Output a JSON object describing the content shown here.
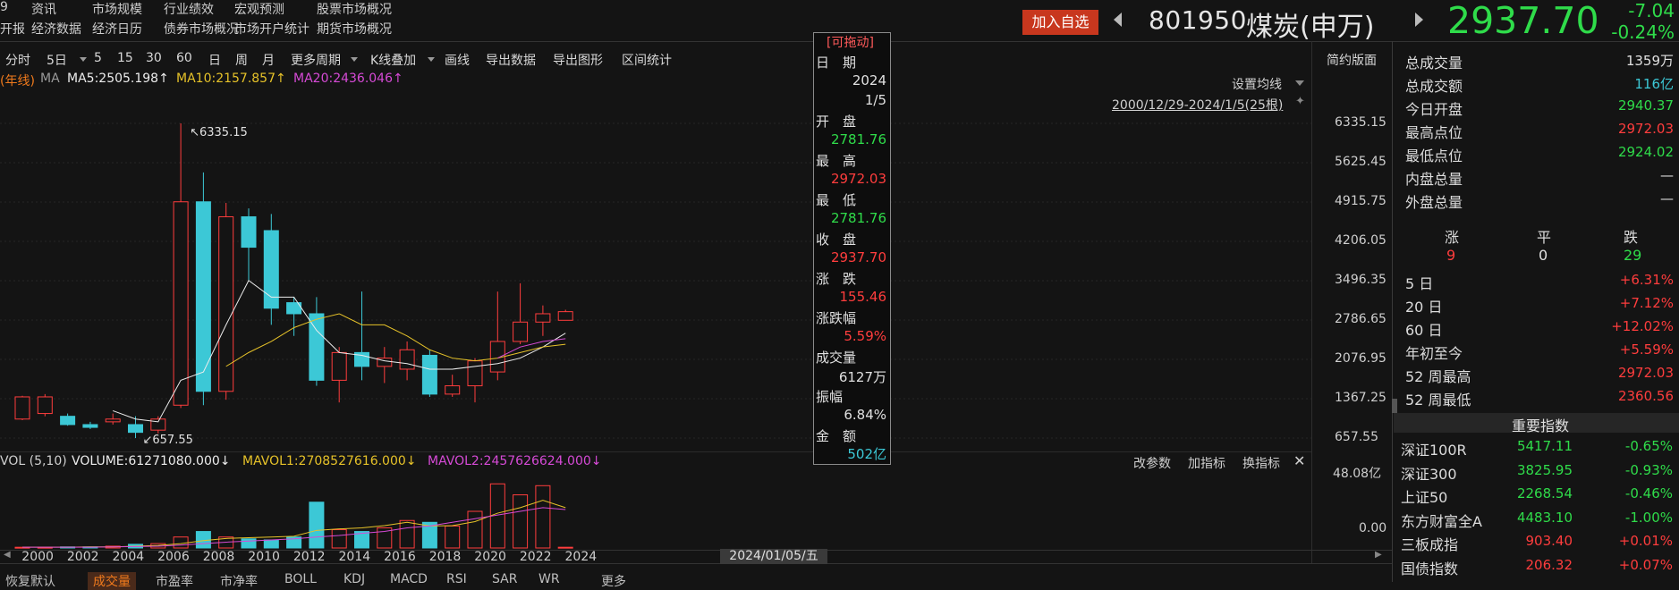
{
  "topnav": {
    "row1": [
      "9",
      "资讯",
      "市场规模",
      "行业绩效",
      "宏观预测",
      "股票市场概况"
    ],
    "row2": [
      "开报",
      "经济数据",
      "经济日历",
      "债券市场概况",
      "市场开户统计",
      "期货市场概况"
    ]
  },
  "header": {
    "add_label": "加入自选",
    "code": "801950",
    "name": "煤炭(申万)",
    "price": "2937.70",
    "change": "-7.04",
    "change_pct": "-0.24%",
    "color_up": "#ff3d3d",
    "color_down": "#2fdc4a"
  },
  "toolbar": {
    "items": [
      "分时",
      "5日",
      "5",
      "15",
      "30",
      "60",
      "日",
      "周",
      "月",
      "更多周期",
      "K线叠加",
      "画线",
      "导出数据",
      "导出图形",
      "区间统计"
    ],
    "simple_label": "简约版面"
  },
  "ma": {
    "prefix": "(年线)",
    "ma_label": "MA",
    "ma5": "MA5:2505.198↑",
    "ma10": "MA10:2157.857↑",
    "ma20": "MA20:2436.046↑",
    "setting": "设置均线",
    "range": "2000/12/29-2024/1/5(25根)"
  },
  "vol": {
    "label": "VOL (5,10)",
    "volume": "VOLUME:61271080.000↓",
    "mavol1": "MAVOL1:2708527616.000↓",
    "mavol2": "MAVOL2:2457626624.000↓",
    "btn_params": "改参数",
    "btn_add": "加指标",
    "btn_switch": "换指标",
    "close_icon": "close-icon",
    "yaxis": [
      "48.08亿",
      "0.00"
    ]
  },
  "tooltip": {
    "drag": "[可拖动]",
    "date_label": "日　期",
    "date_year": "2024",
    "date_md": "1/5",
    "open_label": "开　盘",
    "open": "2781.76",
    "high_label": "最　高",
    "high": "2972.03",
    "low_label": "最　低",
    "low": "2781.76",
    "close_label": "收　盘",
    "close": "2937.70",
    "chg_label": "涨　跌",
    "chg": "155.46",
    "chgpct_label": "涨跌幅",
    "chgpct": "5.59%",
    "vol_label": "成交量",
    "vol": "6127万",
    "amp_label": "振幅",
    "amp": "6.84%",
    "amt_label": "金　额",
    "amt": "502亿"
  },
  "xaxis": {
    "years": [
      "2000",
      "2002",
      "2004",
      "2006",
      "2008",
      "2010",
      "2012",
      "2014",
      "2016",
      "2018",
      "2020",
      "2022",
      "2024"
    ],
    "cursor_date": "2024/01/05/五"
  },
  "bottom_tabs": [
    "恢复默认",
    "成交量",
    "市盈率",
    "市净率",
    "BOLL",
    "KDJ",
    "MACD",
    "RSI",
    "SAR",
    "WR",
    "更多"
  ],
  "stats": [
    {
      "label": "总成交量",
      "value": "1359万",
      "color": "white"
    },
    {
      "label": "总成交额",
      "value": "116亿",
      "color": "cyan"
    },
    {
      "label": "今日开盘",
      "value": "2940.37",
      "color": "green"
    },
    {
      "label": "最高点位",
      "value": "2972.03",
      "color": "red"
    },
    {
      "label": "最低点位",
      "value": "2924.02",
      "color": "green"
    },
    {
      "label": "内盘总量",
      "value": "—",
      "color": "white"
    },
    {
      "label": "外盘总量",
      "value": "—",
      "color": "white"
    }
  ],
  "breadth": {
    "up_label": "涨",
    "flat_label": "平",
    "down_label": "跌",
    "up": "9",
    "flat": "0",
    "down": "29"
  },
  "periods": [
    {
      "label": "5 日",
      "value": "+6.31%"
    },
    {
      "label": "20 日",
      "value": "+7.12%"
    },
    {
      "label": "60 日",
      "value": "+12.02%"
    },
    {
      "label": "年初至今",
      "value": "+5.59%"
    },
    {
      "label": "52 周最高",
      "value": "2972.03"
    },
    {
      "label": "52 周最低",
      "value": "2360.56"
    }
  ],
  "indices": {
    "title": "重要指数",
    "rows": [
      {
        "name": "深证100R",
        "value": "5417.11",
        "pct": "-0.65%",
        "color": "green"
      },
      {
        "name": "深证300",
        "value": "3825.95",
        "pct": "-0.93%",
        "color": "green"
      },
      {
        "name": "上证50",
        "value": "2268.54",
        "pct": "-0.46%",
        "color": "green"
      },
      {
        "name": "东方财富全A",
        "value": "4483.10",
        "pct": "-1.00%",
        "color": "green"
      },
      {
        "name": "三板成指",
        "value": "903.40",
        "pct": "+0.01%",
        "color": "red"
      },
      {
        "name": "国债指数",
        "value": "206.32",
        "pct": "+0.07%",
        "color": "red"
      }
    ]
  },
  "chart_data": {
    "type": "candlestick",
    "y_ticks": [
      "6335.15",
      "5625.45",
      "4915.75",
      "4206.05",
      "3496.35",
      "2786.65",
      "2076.95",
      "1367.25",
      "657.55"
    ],
    "ylim": [
      657.55,
      6335.15
    ],
    "high_marker": "6335.15",
    "low_marker": "657.55",
    "candles": [
      {
        "year": "2001",
        "o": 1000,
        "c": 1400,
        "h": 1420,
        "l": 980
      },
      {
        "year": "2002",
        "o": 1100,
        "c": 1400,
        "h": 1450,
        "l": 1050
      },
      {
        "year": "2003",
        "o": 1050,
        "c": 900,
        "h": 1100,
        "l": 880
      },
      {
        "year": "2004",
        "o": 900,
        "c": 850,
        "h": 950,
        "l": 820
      },
      {
        "year": "2005",
        "o": 950,
        "c": 1000,
        "h": 1100,
        "l": 900
      },
      {
        "year": "2006",
        "o": 900,
        "c": 760,
        "h": 1050,
        "l": 657.55
      },
      {
        "year": "2007",
        "o": 800,
        "c": 1000,
        "h": 1050,
        "l": 740
      },
      {
        "year": "2008",
        "o": 1250,
        "c": 4920,
        "h": 6335.15,
        "l": 1200
      },
      {
        "year": "2009",
        "o": 4920,
        "c": 1500,
        "h": 5450,
        "l": 1250
      },
      {
        "year": "2010",
        "o": 1500,
        "c": 4650,
        "h": 4900,
        "l": 1350
      },
      {
        "year": "2011",
        "o": 4650,
        "c": 4100,
        "h": 4800,
        "l": 3500
      },
      {
        "year": "2012",
        "o": 4400,
        "c": 3000,
        "h": 4700,
        "l": 2700
      },
      {
        "year": "2013",
        "o": 3100,
        "c": 2900,
        "h": 3200,
        "l": 2500
      },
      {
        "year": "2014",
        "o": 2900,
        "c": 1700,
        "h": 3200,
        "l": 1600
      },
      {
        "year": "2015",
        "o": 1700,
        "c": 2200,
        "h": 2300,
        "l": 1300
      },
      {
        "year": "2016",
        "o": 2200,
        "c": 1950,
        "h": 3300,
        "l": 1700
      },
      {
        "year": "2017",
        "o": 1950,
        "c": 2100,
        "h": 2300,
        "l": 1650
      },
      {
        "year": "2018",
        "o": 1900,
        "c": 2250,
        "h": 2400,
        "l": 1700
      },
      {
        "year": "2019",
        "o": 2150,
        "c": 1450,
        "h": 2250,
        "l": 1400
      },
      {
        "year": "2020",
        "o": 1450,
        "c": 1600,
        "h": 1800,
        "l": 1400
      },
      {
        "year": "2021",
        "o": 1600,
        "c": 2050,
        "h": 2100,
        "l": 1300
      },
      {
        "year": "2022",
        "o": 1850,
        "c": 2400,
        "h": 3300,
        "l": 1700
      },
      {
        "year": "2023",
        "o": 2400,
        "c": 2750,
        "h": 3450,
        "l": 2350
      },
      {
        "year": "2024",
        "o": 2750,
        "c": 2900,
        "h": 3050,
        "l": 2500
      },
      {
        "year": "2024/1",
        "o": 2781.76,
        "c": 2937.7,
        "h": 2972.03,
        "l": 2781.76
      }
    ],
    "ma5": [
      null,
      null,
      null,
      null,
      1150,
      1000,
      950,
      1700,
      1850,
      2700,
      3500,
      3200,
      3200,
      2600,
      2200,
      2150,
      2050,
      2000,
      1900,
      1900,
      1950,
      2000,
      2100,
      2300,
      2550
    ],
    "ma10": [
      null,
      null,
      null,
      null,
      null,
      null,
      null,
      null,
      null,
      1950,
      2200,
      2400,
      2650,
      2800,
      2900,
      2700,
      2700,
      2500,
      2250,
      2100,
      2050,
      2100,
      2200,
      2300,
      2350
    ],
    "ma20": [
      null,
      null,
      null,
      null,
      null,
      null,
      null,
      null,
      null,
      null,
      null,
      null,
      null,
      null,
      null,
      null,
      null,
      null,
      null,
      null,
      null,
      2100,
      2300,
      2400,
      2450
    ],
    "volume": [
      0.02,
      0.02,
      0.03,
      0.03,
      0.05,
      0.1,
      0.12,
      0.3,
      0.45,
      0.3,
      0.25,
      0.22,
      0.3,
      1.25,
      0.5,
      0.45,
      0.55,
      0.75,
      0.7,
      0.6,
      1.0,
      1.75,
      1.45,
      1.7,
      0.02
    ],
    "mavol1": [
      0.02,
      0.02,
      0.02,
      0.03,
      0.03,
      0.05,
      0.07,
      0.12,
      0.2,
      0.26,
      0.28,
      0.3,
      0.32,
      0.48,
      0.52,
      0.55,
      0.61,
      0.7,
      0.6,
      0.61,
      0.72,
      0.95,
      1.1,
      1.3,
      1.1
    ],
    "mavol2": [
      0.02,
      0.02,
      0.02,
      0.02,
      0.03,
      0.04,
      0.05,
      0.08,
      0.12,
      0.16,
      0.19,
      0.22,
      0.25,
      0.3,
      0.34,
      0.4,
      0.45,
      0.55,
      0.6,
      0.7,
      0.8,
      0.9,
      1.0,
      1.1,
      1.05
    ],
    "vol_ylim": [
      0,
      2.0
    ],
    "up_color": "#ff3d3d",
    "down_color": "#3cc8d6",
    "ma5_color": "#ececec",
    "ma10_color": "#e6c229",
    "ma20_color": "#d64ad6"
  }
}
